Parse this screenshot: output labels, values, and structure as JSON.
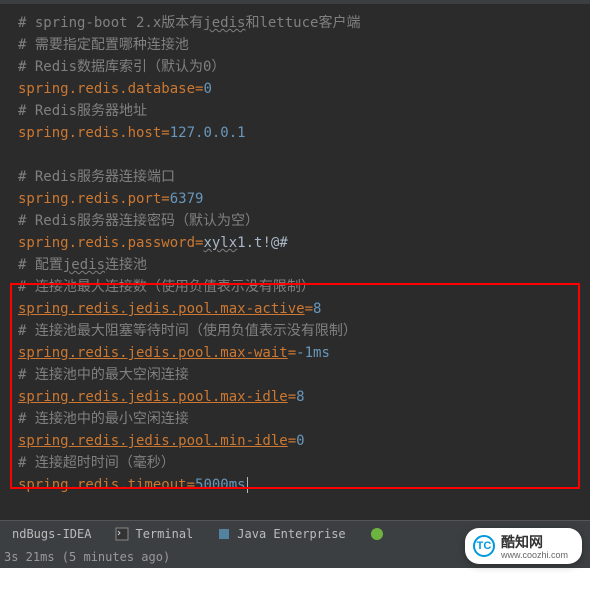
{
  "lines": [
    {
      "type": "comment",
      "text": "# spring-boot 2.x版本有jedis和lettuce客户端",
      "u": [
        "jedis"
      ]
    },
    {
      "type": "comment",
      "text": "# 需要指定配置哪种连接池"
    },
    {
      "type": "comment",
      "text": "# Redis数据库索引（默认为0）"
    },
    {
      "type": "prop",
      "key": "spring.redis.database",
      "val": "0",
      "valType": "num"
    },
    {
      "type": "comment",
      "text": "# Redis服务器地址"
    },
    {
      "type": "prop",
      "key": "spring.redis.host",
      "val": "127.0.0.1",
      "valType": "num"
    },
    {
      "type": "blank"
    },
    {
      "type": "comment",
      "text": "# Redis服务器连接端口"
    },
    {
      "type": "prop",
      "key": "spring.redis.port",
      "val": "6379",
      "valType": "num"
    },
    {
      "type": "comment",
      "text": "# Redis服务器连接密码（默认为空）"
    },
    {
      "type": "prop",
      "key": "spring.redis.password",
      "val": "xylx1.t!@#",
      "valType": "txt",
      "valU": [
        "xylx"
      ]
    },
    {
      "type": "comment",
      "text": "# 配置jedis连接池",
      "u": [
        "jedis"
      ]
    },
    {
      "type": "comment",
      "text": "# 连接池最大连接数（使用负值表示没有限制）"
    },
    {
      "type": "prop",
      "key": "spring.redis.jedis.pool.max-active",
      "val": "8",
      "valType": "num",
      "keyU": true
    },
    {
      "type": "comment",
      "text": "# 连接池最大阻塞等待时间（使用负值表示没有限制）"
    },
    {
      "type": "prop",
      "key": "spring.redis.jedis.pool.max-wait",
      "val": "-1ms",
      "valType": "num",
      "keyU": true
    },
    {
      "type": "comment",
      "text": "# 连接池中的最大空闲连接"
    },
    {
      "type": "prop",
      "key": "spring.redis.jedis.pool.max-idle",
      "val": "8",
      "valType": "num",
      "keyU": true
    },
    {
      "type": "comment",
      "text": "# 连接池中的最小空闲连接"
    },
    {
      "type": "prop",
      "key": "spring.redis.jedis.pool.min-idle",
      "val": "0",
      "valType": "num",
      "keyU": true
    },
    {
      "type": "comment",
      "text": "# 连接超时时间（毫秒）"
    },
    {
      "type": "prop",
      "key": "spring.redis.timeout",
      "val": "5000ms",
      "valType": "num",
      "cursor": true
    }
  ],
  "bottomTabs": {
    "findbugs": "ndBugs-IDEA",
    "terminal": "Terminal",
    "java": "Java Enterprise"
  },
  "status": "3s 21ms (5 minutes ago)",
  "watermark": {
    "logo": "TC",
    "title": "酷知网",
    "sub": "www.coozhi.com"
  }
}
